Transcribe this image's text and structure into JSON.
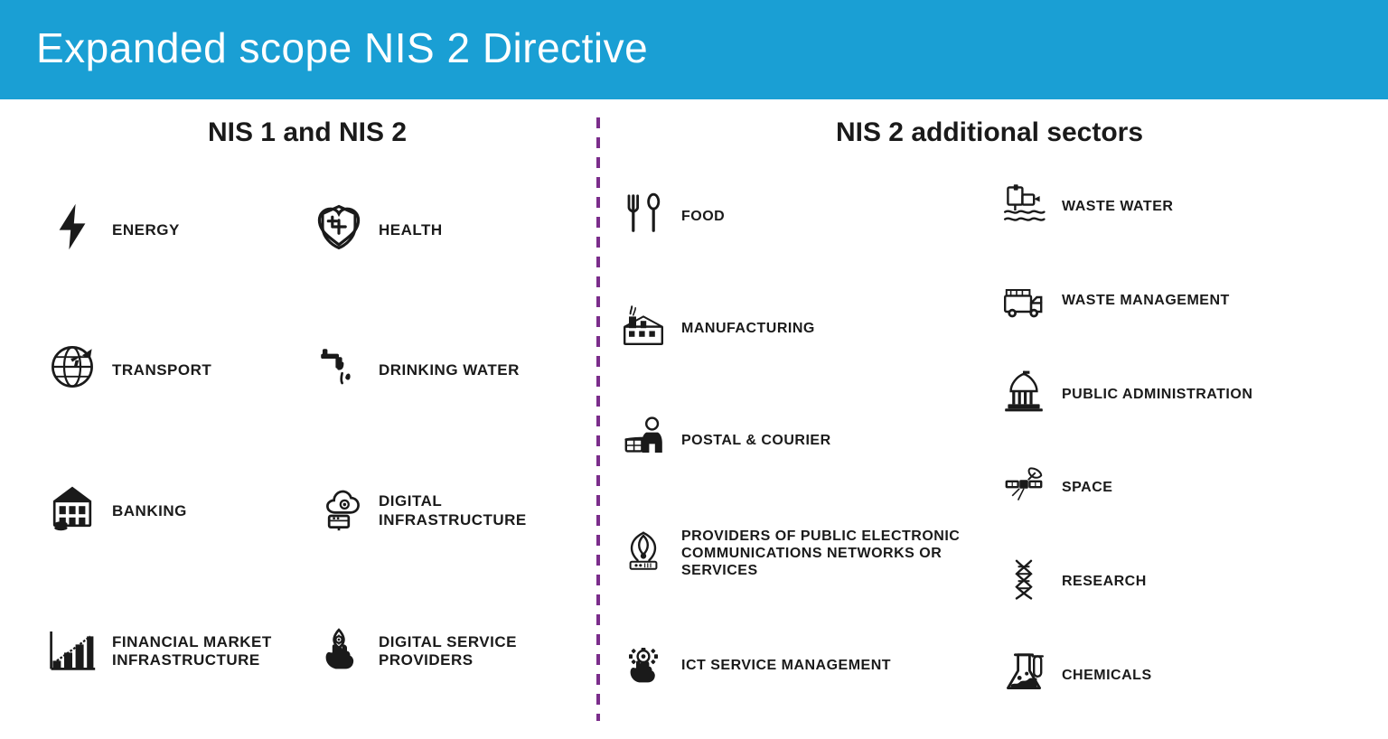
{
  "header": {
    "title": "Expanded scope NIS 2 Directive"
  },
  "left_section": {
    "title": "NIS 1 and NIS 2",
    "sectors": [
      {
        "id": "energy",
        "label": "ENERGY",
        "icon": "⚡"
      },
      {
        "id": "health",
        "label": "HEALTH",
        "icon": "🛡️"
      },
      {
        "id": "transport",
        "label": "TRANSPORT",
        "icon": "🌐✈"
      },
      {
        "id": "drinking-water",
        "label": "DRINKING WATER",
        "icon": "🚰"
      },
      {
        "id": "banking",
        "label": "BANKING",
        "icon": "🏦"
      },
      {
        "id": "digital-infrastructure",
        "label": "DIGITAL INFRASTRUCTURE",
        "icon": "☁️"
      },
      {
        "id": "financial-market",
        "label": "FINANCIAL MARKET INFRASTRUCTURE",
        "icon": "📊"
      },
      {
        "id": "digital-service",
        "label": "DIGITAL SERVICE PROVIDERS",
        "icon": "🖐️"
      }
    ]
  },
  "right_section": {
    "title": "NIS 2 additional sectors",
    "col1": [
      {
        "id": "food",
        "label": "FOOD",
        "icon": "🍴"
      },
      {
        "id": "manufacturing",
        "label": "MANUFACTURING",
        "icon": "🏭"
      },
      {
        "id": "postal",
        "label": "POSTAL & COURIER",
        "icon": "📦"
      },
      {
        "id": "providers",
        "label": "PROVIDERS OF PUBLIC ELECTRONIC COMMUNICATIONS NETWORKS OR SERVICES",
        "icon": "📡"
      },
      {
        "id": "ict",
        "label": "ICT SERVICE MANAGEMENT",
        "icon": "⚙️"
      }
    ],
    "col2": [
      {
        "id": "waste-water",
        "label": "WASTE WATER",
        "icon": "💧"
      },
      {
        "id": "waste-management",
        "label": "WASTE MANAGEMENT",
        "icon": "🚛"
      },
      {
        "id": "public-admin",
        "label": "PUBLIC ADMINISTRATION",
        "icon": "🏛️"
      },
      {
        "id": "space",
        "label": "SPACE",
        "icon": "🛰️"
      },
      {
        "id": "research",
        "label": "RESEARCH",
        "icon": "🧬"
      },
      {
        "id": "chemicals",
        "label": "CHEMICALS",
        "icon": "🧪"
      }
    ]
  }
}
